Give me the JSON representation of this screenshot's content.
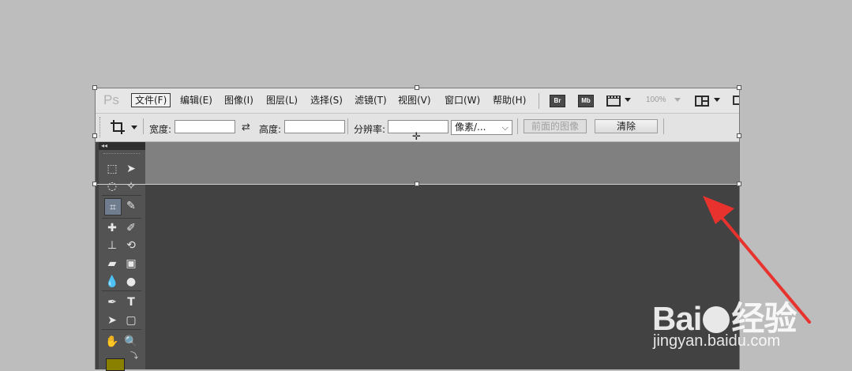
{
  "app": {
    "logo": "Ps",
    "menus": [
      "文件(F)",
      "编辑(E)",
      "图像(I)",
      "图层(L)",
      "选择(S)",
      "滤镜(T)",
      "视图(V)",
      "窗口(W)",
      "帮助(H)"
    ],
    "bridge_badge": "Br",
    "minibridge_badge": "Mb",
    "zoom": "100%"
  },
  "options_bar": {
    "width_label": "宽度:",
    "height_label": "高度:",
    "resolution_label": "分辨率:",
    "unit_value": "像素/...",
    "front_image_button": "前面的图像",
    "clear_button": "清除"
  },
  "watermark": {
    "brand": "Bai",
    "brand_suffix": "经验",
    "url": "jingyan.baidu.com"
  },
  "colors": {
    "annotation_arrow": "#e8322d",
    "foreground_swatch": "#8a8000",
    "selected_tool": "#6f7d8f"
  }
}
